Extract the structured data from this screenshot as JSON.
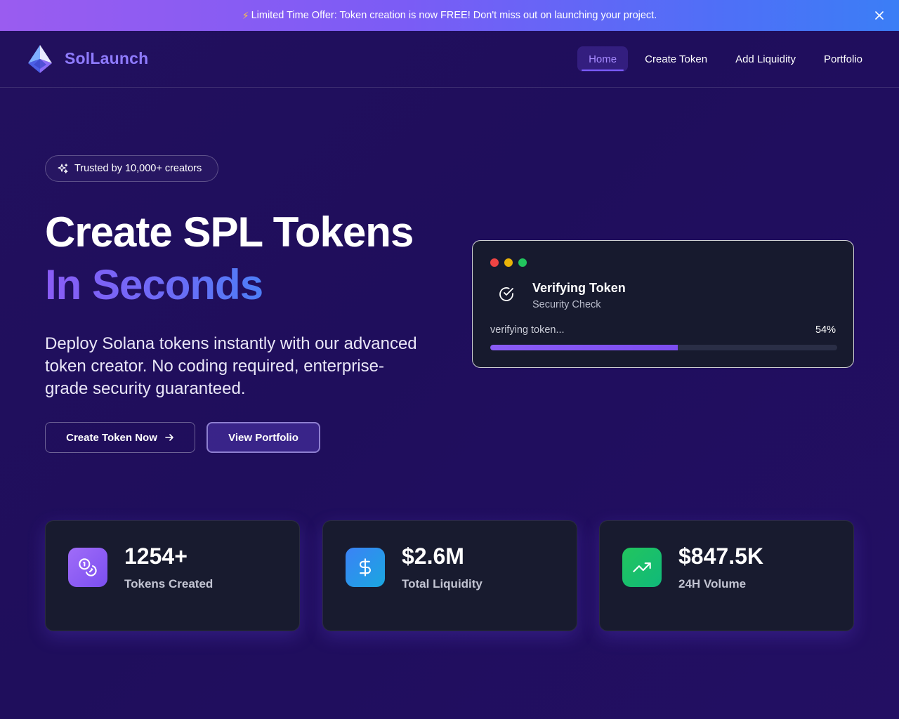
{
  "banner": {
    "text": "Limited Time Offer: Token creation is now FREE! Don't miss out on launching your project.",
    "icon": "lightning-icon"
  },
  "nav": {
    "brand": "SolLaunch",
    "links": [
      {
        "label": "Home",
        "active": true
      },
      {
        "label": "Create Token",
        "active": false
      },
      {
        "label": "Add Liquidity",
        "active": false
      },
      {
        "label": "Portfolio",
        "active": false
      }
    ]
  },
  "hero": {
    "badge": "Trusted by 10,000+ creators",
    "title_line1": "Create SPL Tokens",
    "title_line2": "In Seconds",
    "description": "Deploy Solana tokens instantly with our advanced token creator. No coding required, enterprise-grade security guaranteed.",
    "primary_button": "Create Token Now",
    "secondary_button": "View Portfolio"
  },
  "verify_card": {
    "title": "Verifying Token",
    "subtitle": "Security Check",
    "status": "verifying token...",
    "progress_label": "54%",
    "progress": 0.54
  },
  "stats": [
    {
      "value": "1254+",
      "label": "Tokens Created",
      "icon": "coins-icon"
    },
    {
      "value": "$2.6M",
      "label": "Total Liquidity",
      "icon": "dollar-icon"
    },
    {
      "value": "$847.5K",
      "label": "24H Volume",
      "icon": "trending-up-icon"
    }
  ],
  "colors": {
    "accent": "#7c5cff",
    "stat_purple": "#8b5cf6",
    "stat_blue": "#2f8ff0",
    "stat_green": "#22c55e",
    "dot_red": "#ef4444",
    "dot_yellow": "#eab308",
    "dot_green": "#22c55e"
  }
}
